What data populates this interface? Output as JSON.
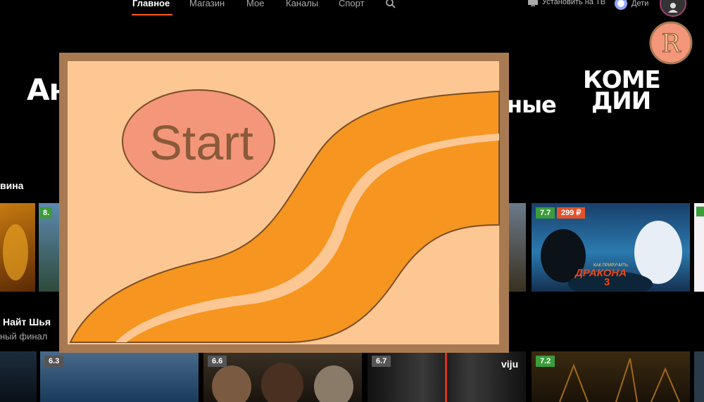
{
  "nav": {
    "tabs": [
      "Главное",
      "Магазин",
      "Мое",
      "Каналы",
      "Спорт"
    ],
    "install_tv": "Установить на ТВ",
    "kids": "Дети"
  },
  "badge_letter": "R",
  "genres": {
    "left": "Ан",
    "middle": "ные",
    "comedy_line1": "КОМЕ",
    "comedy_line2": "ДИИ"
  },
  "sections": [
    {
      "title": "вина"
    },
    {
      "title": "Найт Шья",
      "subtitle": "ный финал"
    }
  ],
  "cards_row1": [
    {
      "rating": "8."
    },
    {
      "rating": "7.7",
      "price": "299 ₽",
      "title_line1": "ДРАКОНА",
      "title_line2": "3",
      "tagline": "КАК ПРИРУЧИТЬ"
    }
  ],
  "cards_row2": [
    {
      "rating": "6.3"
    },
    {
      "rating": "6.6"
    },
    {
      "rating": "6.7",
      "provider": "viju"
    },
    {
      "rating": "7.2"
    }
  ],
  "game": {
    "start_label": "Start",
    "colors": {
      "frame": "#a87a52",
      "background": "#fcc793",
      "river": "#f6951f",
      "start_button": "#f4967a"
    }
  }
}
